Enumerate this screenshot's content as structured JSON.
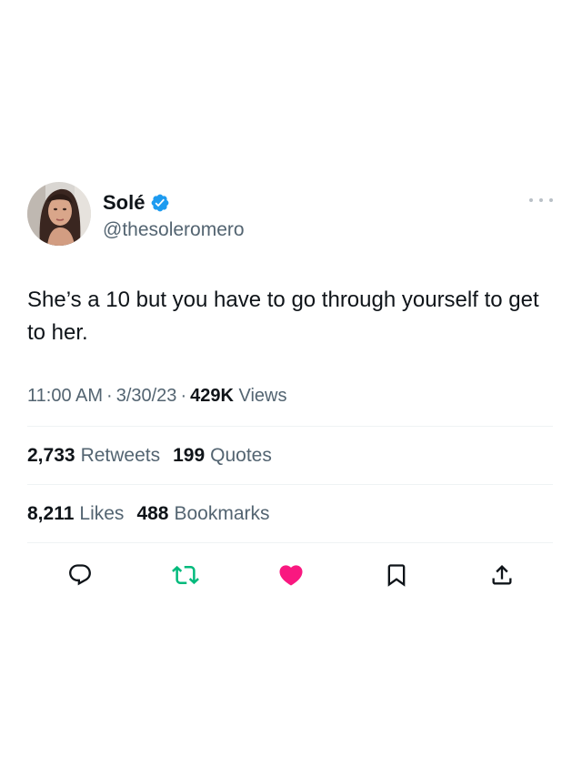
{
  "author": {
    "display_name": "Solé",
    "handle": "@thesoleromero",
    "verified": true
  },
  "tweet": {
    "text": "She’s a 10 but you have to go through yourself to get to her.",
    "time": "11:00 AM",
    "date": "3/30/23",
    "views_count": "429K",
    "views_label": "Views"
  },
  "stats": {
    "retweets_count": "2,733",
    "retweets_label": "Retweets",
    "quotes_count": "199",
    "quotes_label": "Quotes",
    "likes_count": "8,211",
    "likes_label": "Likes",
    "bookmarks_count": "488",
    "bookmarks_label": "Bookmarks"
  },
  "actions": [
    {
      "icon": "reply-icon"
    },
    {
      "icon": "retweet-icon",
      "color": "#00ba7c"
    },
    {
      "icon": "like-icon",
      "color": "#f91880"
    },
    {
      "icon": "bookmark-icon"
    },
    {
      "icon": "share-icon"
    }
  ],
  "colors": {
    "verified": "#1d9bf0",
    "secondary_text": "#536471",
    "primary_text": "#0f1419",
    "divider": "#eff3f4"
  }
}
